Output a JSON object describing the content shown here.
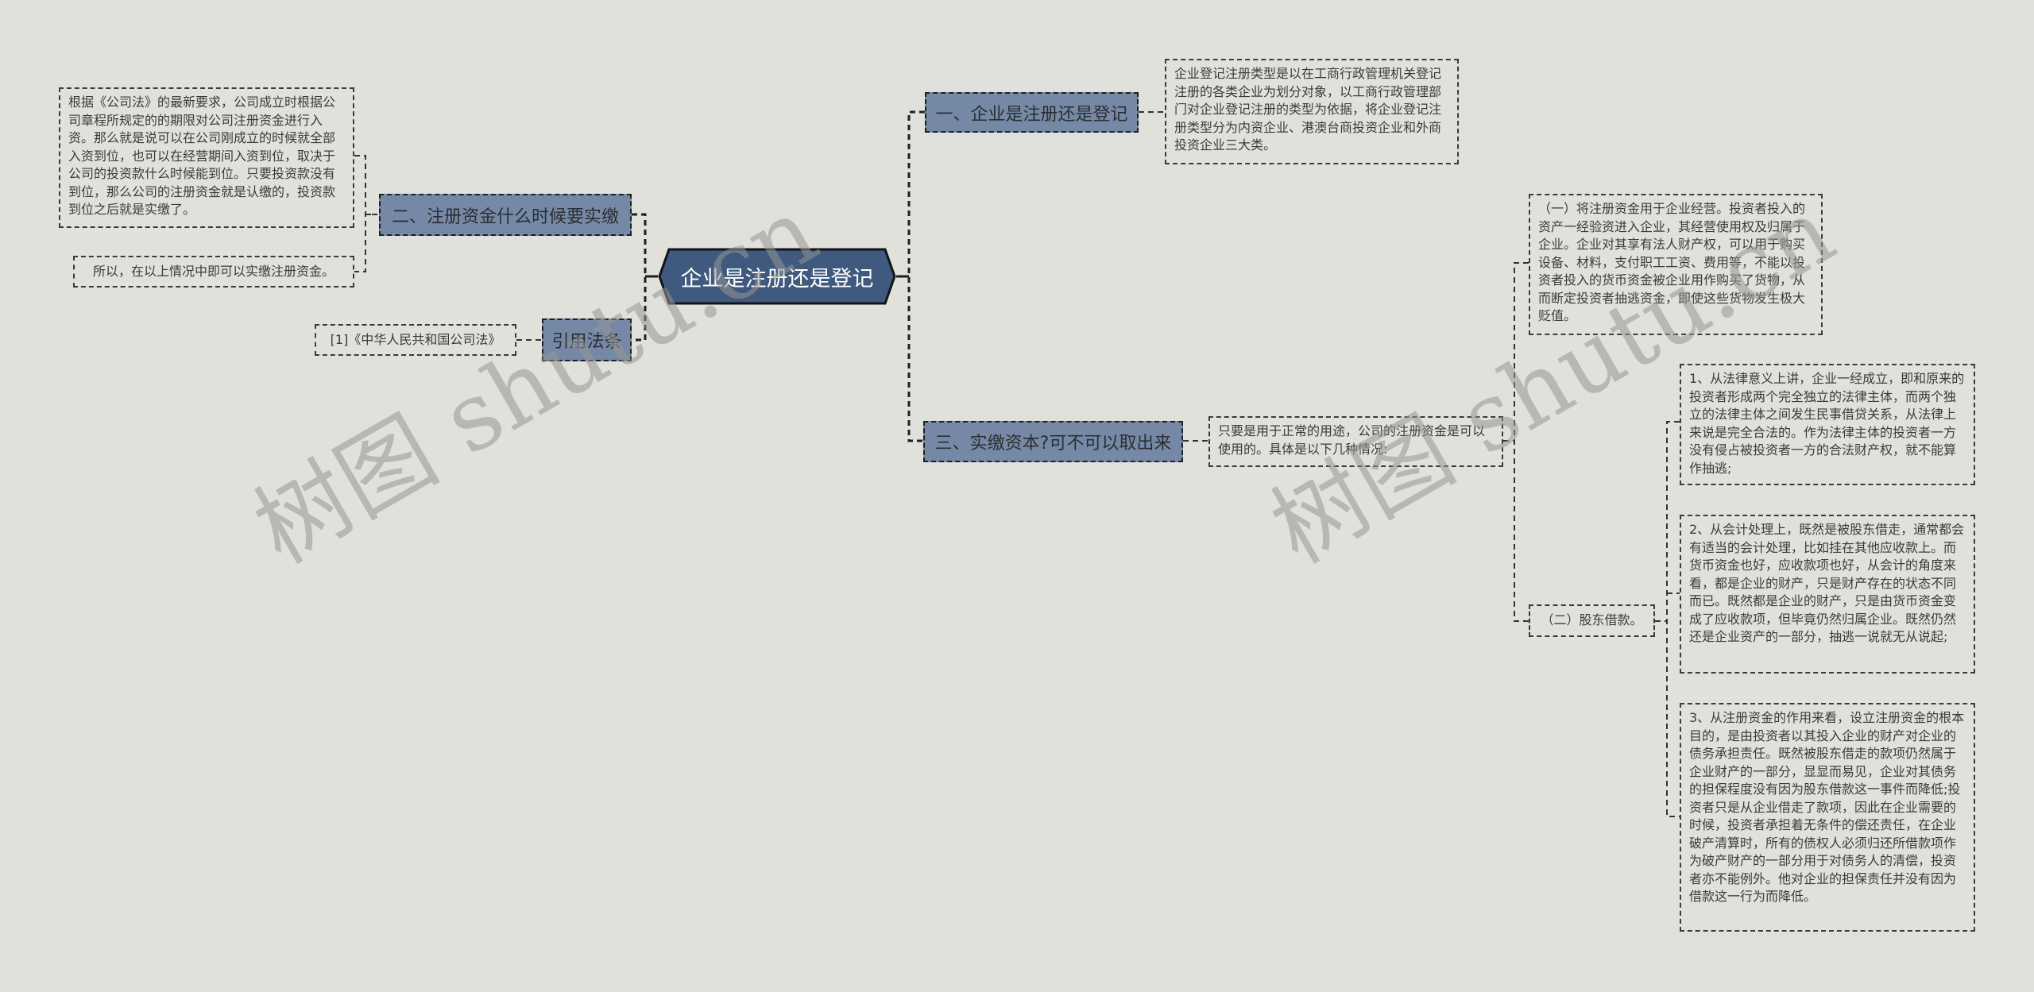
{
  "root": {
    "label": "企业是注册还是登记"
  },
  "branches": [
    {
      "label": "一、企业是注册还是登记",
      "children": [
        {
          "text": "企业登记注册类型是以在工商行政管理机关登记注册的各类企业为划分对象，以工商行政管理部门对企业登记注册的类型为依据，将企业登记注册类型分为内资企业、港澳台商投资企业和外商投资企业三大类。"
        }
      ]
    },
    {
      "label": "二、注册资金什么时候要实缴",
      "children": [
        {
          "text": "根据《公司法》的最新要求，公司成立时根据公司章程所规定的的期限对公司注册资金进行入资。那么就是说可以在公司刚成立的时候就全部入资到位，也可以在经营期间入资到位，取决于公司的投资款什么时候能到位。只要投资款没有到位，那么公司的注册资金就是认缴的，投资款到位之后就是实缴了。"
        },
        {
          "text": "所以，在以上情况中即可以实缴注册资金。"
        }
      ]
    },
    {
      "label": "引用法条",
      "children": [
        {
          "text": "[1]《中华人民共和国公司法》"
        }
      ]
    },
    {
      "label": "三、实缴资本?可不可以取出来",
      "children": [
        {
          "text": "只要是用于正常的用途，公司的注册资金是可以使用的。具体是以下几种情况:",
          "children": [
            {
              "text": "（一）将注册资金用于企业经营。投资者投入的资产一经验资进入企业，其经营使用权及归属于企业。企业对其享有法人财产权，可以用于购买设备、材料，支付职工工资、费用等，不能以投资者投入的货币资金被企业用作购买了货物，从而断定投资者抽逃资金，即使这些货物发生极大贬值。"
            },
            {
              "text": "（二）股东借款。",
              "children": [
                {
                  "text": "1、从法律意义上讲，企业一经成立，即和原来的投资者形成两个完全独立的法律主体，而两个独立的法律主体之间发生民事借贷关系，从法律上来说是完全合法的。作为法律主体的投资者一方没有侵占被投资者一方的合法财产权，就不能算作抽逃;"
                },
                {
                  "text": "2、从会计处理上，既然是被股东借走，通常都会有适当的会计处理，比如挂在其他应收款上。而货币资金也好，应收款项也好，从会计的角度来看，都是企业的财产，只是财产存在的状态不同而已。既然都是企业的财产，只是由货币资金变成了应收款项，但毕竟仍然归属企业。既然仍然还是企业资产的一部分，抽逃一说就无从说起;"
                },
                {
                  "text": "3、从注册资金的作用来看，设立注册资金的根本目的，是由投资者以其投入企业的财产对企业的债务承担责任。既然被股东借走的款项仍然属于企业财产的一部分，显显而易见，企业对其债务的担保程度没有因为股东借款这一事件而降低;投资者只是从企业借走了款项，因此在企业需要的时候，投资者承担着无条件的偿还责任，在企业破产清算时，所有的债权人必须归还所借款项作为破产财产的一部分用于对债务人的清偿，投资者亦不能例外。他对企业的担保责任并没有因为借款这一行为而降低。"
                }
              ]
            }
          ]
        }
      ]
    }
  ],
  "watermarks": [
    "树图 shutu.cn",
    "树图 shutu.cn"
  ],
  "colors": {
    "background": "#e1e1dc",
    "root_fill": "#3f5a7e",
    "branch_fill": "#7589a6",
    "border": "#1c1f24",
    "text": "#333333"
  }
}
